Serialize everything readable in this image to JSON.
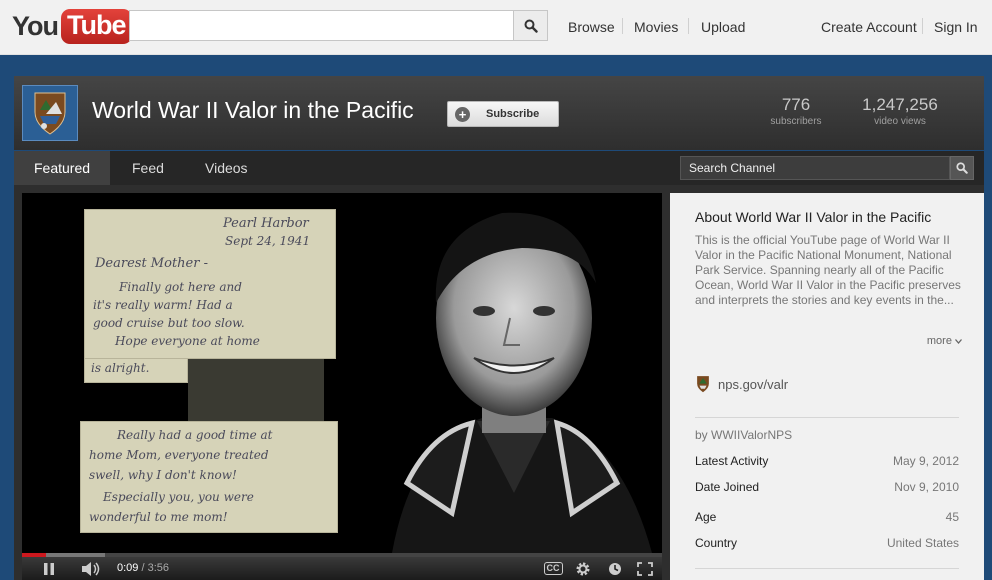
{
  "masthead": {
    "logo_you": "You",
    "logo_tube": "Tube",
    "search_placeholder": "",
    "nav": [
      "Browse",
      "Movies",
      "Upload"
    ],
    "create_account": "Create Account",
    "sign_in": "Sign In"
  },
  "channel": {
    "title": "World War II Valor in the Pacific",
    "subscribe_label": "Subscribe",
    "stats": [
      {
        "value": "776",
        "label": "subscribers"
      },
      {
        "value": "1,247,256",
        "label": "video views"
      }
    ]
  },
  "tabs": [
    {
      "label": "Featured",
      "active": true
    },
    {
      "label": "Feed",
      "active": false
    },
    {
      "label": "Videos",
      "active": false
    }
  ],
  "channel_search_placeholder": "Search Channel",
  "player": {
    "letter_top_lines": [
      "Pearl Harbor",
      "Sept 24, 1941",
      "Dearest Mother -",
      "Finally got here and",
      "it's really warm! Had a",
      "good cruise but too slow.",
      "Hope everyone at home",
      "is alright."
    ],
    "letter_bottom_lines": [
      "Really had a good time at",
      "home Mom, everyone treated",
      "swell, why I don't know!",
      "Especially you, you were",
      "wonderful to me mom!"
    ],
    "time_current": "0:09",
    "time_separator": "/",
    "time_total": "3:56",
    "played_fraction": 0.038,
    "loaded_fraction": 0.13,
    "cc_label": "CC"
  },
  "sidebar": {
    "about_title": "About World War II Valor in the Pacific",
    "description": "This is the official YouTube page of World War II Valor in the Pacific National Monument, National Park Service. Spanning nearly all of the Pacific Ocean, World War II Valor in the Pacific preserves and interprets the stories and key events in the...",
    "more_label": "more",
    "website": "nps.gov/valr",
    "by_line": "by WWIIValorNPS",
    "info": [
      {
        "label": "Latest Activity",
        "value": "May 9, 2012"
      },
      {
        "label": "Date Joined",
        "value": "Nov 9, 2010"
      },
      {
        "label": "Age",
        "value": "45"
      },
      {
        "label": "Country",
        "value": "United States"
      }
    ]
  },
  "colors": {
    "page_background": "#1e4a78",
    "youtube_red": "#cc181e",
    "header_dark": "#3a3a3a"
  }
}
